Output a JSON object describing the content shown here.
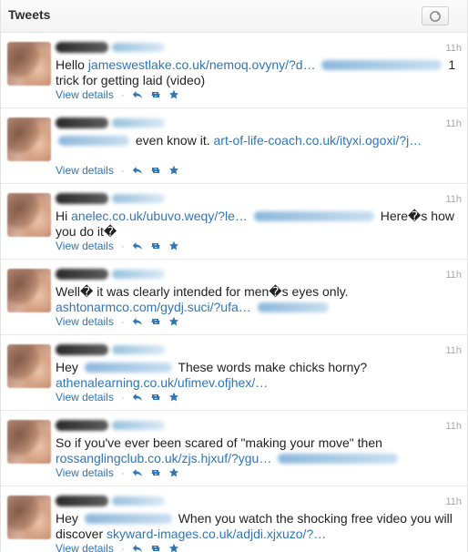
{
  "header": {
    "title": "Tweets",
    "refresh_icon": "refresh-icon"
  },
  "tweets": [
    {
      "time": "11h",
      "text_before": "Hello ",
      "link1": "jameswestlake.co.uk/nemoq.ovyny/?d…",
      "text_after": " 1 trick for getting laid (video)",
      "view_details": "View details"
    },
    {
      "time": "11h",
      "text_before": " even know it. ",
      "link1": "art-of-life-coach.co.uk/ityxi.ogoxi/?j…",
      "text_after": "",
      "view_details": "View details"
    },
    {
      "time": "11h",
      "text_before": "Hi ",
      "link1": "anelec.co.uk/ubuvo.weqy/?le…",
      "text_after": " Here�s how you do it�",
      "view_details": "View details"
    },
    {
      "time": "11h",
      "text_before": "Well� it was clearly intended for men�s eyes only. ",
      "link1": "ashtonarmco.com/gydj.suci/?ufa…",
      "text_after": "",
      "view_details": "View details"
    },
    {
      "time": "11h",
      "text_before": "Hey ",
      "link1": "athenalearning.co.uk/ufimev.ofjhex/…",
      "text_after": " These words make chicks horny?",
      "view_details": "View details"
    },
    {
      "time": "11h",
      "text_before": "So if you've ever been scared of \"making your move\" then ",
      "link1": "rossanglingclub.co.uk/zjs.hjxuf/?ygu…",
      "text_after": "",
      "view_details": "View details"
    },
    {
      "time": "11h",
      "text_before": "Hey ",
      "link1": "skyward-images.co.uk/adjdi.xjxuzo/?…",
      "text_after": " When you watch the shocking free video you will discover ",
      "view_details": "View details"
    }
  ],
  "icons": {
    "reply": "reply-icon",
    "retweet": "retweet-icon",
    "favorite": "star-icon"
  },
  "colors": {
    "link": "#2f76b6",
    "muted": "#a7a7a7",
    "border": "#e8e8e8"
  }
}
